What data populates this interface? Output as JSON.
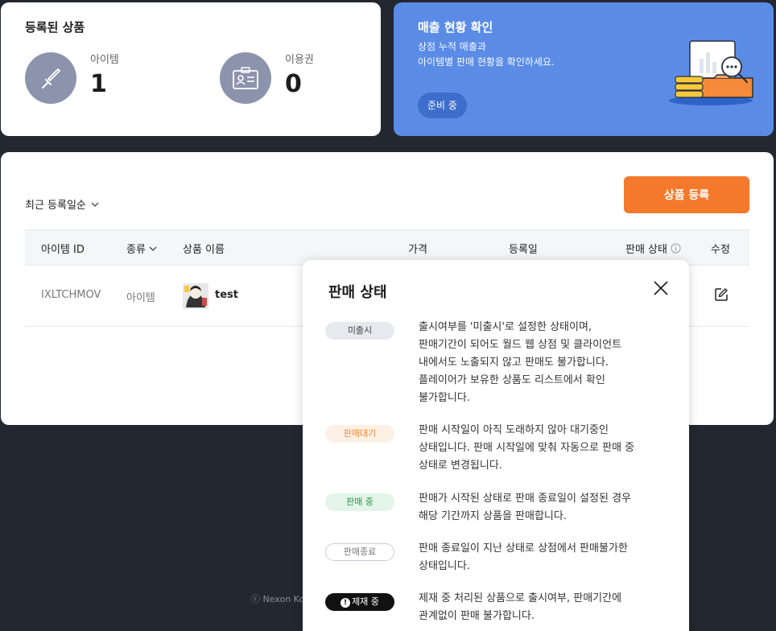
{
  "registered": {
    "title": "등록된 상품",
    "items_label": "아이템",
    "items_count": "1",
    "vouchers_label": "이용권",
    "vouchers_count": "0"
  },
  "sales": {
    "title": "매출 현황 확인",
    "desc_line1": "상점 누적 매출과",
    "desc_line2": "아이템별 판매 현황을 확인하세요.",
    "pill": "준비 중"
  },
  "list": {
    "sort_label": "최근 등록일순",
    "register_button": "상품 등록",
    "columns": {
      "id": "아이템 ID",
      "type": "종류",
      "name": "상품 이름",
      "price": "가격",
      "date": "등록일",
      "status": "판매 상태",
      "edit": "수정"
    },
    "rows": [
      {
        "id": "IXLTCHMOV",
        "type": "아이템",
        "name": "test"
      }
    ]
  },
  "footer": {
    "copyright": "ⓒ Nexon Ko"
  },
  "popup": {
    "title": "판매 상태",
    "statuses": [
      {
        "badge": "미출시",
        "desc": [
          "출시여부를 '미출시'로 설정한 상태이며,",
          "판매기간이 되어도 월드 웹 상점 및 클라이언트",
          "내에서도 노출되지 않고 판매도 불가합니다.",
          "플레이어가 보유한 상품도 리스트에서 확인",
          "불가합니다."
        ]
      },
      {
        "badge": "판매대기",
        "desc": [
          "판매 시작일이 아직 도래하지 않아 대기중인",
          "상태입니다. 판매 시작일에 맞춰 자동으로 판매 중",
          "상태로 변경됩니다."
        ]
      },
      {
        "badge": "판매 중",
        "desc": [
          "판매가 시작된 상태로 판매 종료일이 설정된 경우",
          "해당 기간까지 상품을 판매합니다."
        ]
      },
      {
        "badge": "판매종료",
        "desc": [
          "판매 종료일이 지난 상태로 상점에서 판매불가한",
          "상태입니다."
        ]
      },
      {
        "badge": "제재 중",
        "desc": [
          "제재 중 처리된 상품으로 출시여부, 판매기간에",
          "관계없이 판매 불가합니다."
        ]
      }
    ]
  },
  "colors": {
    "accent_orange": "#f5792a",
    "sales_blue": "#5a8ce6",
    "background_dark": "#232730"
  }
}
